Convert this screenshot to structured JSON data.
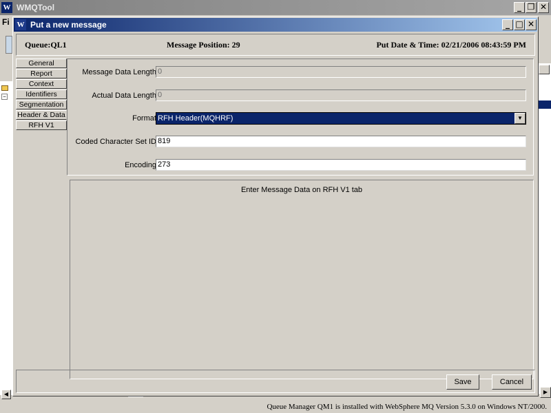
{
  "app": {
    "title": "WMQTool",
    "menu_fragment": "Fi",
    "status_text": "Queue Manager QM1  is installed with WebSphere MQ Version 5.3.0 on Windows NT/2000."
  },
  "dialog": {
    "title": "Put a new message",
    "header": {
      "queue": "Queue:QL1",
      "position": "Message Position: 29",
      "datetime": "Put Date & Time: 02/21/2006 08:43:59 PM"
    },
    "tabs": [
      {
        "label": "General"
      },
      {
        "label": "Report"
      },
      {
        "label": "Context"
      },
      {
        "label": "Identifiers"
      },
      {
        "label": "Segmentation"
      },
      {
        "label": "Header & Data"
      },
      {
        "label": "RFH V1"
      }
    ],
    "fields": {
      "data_length": {
        "label": "Message Data Length:",
        "value": "0"
      },
      "actual_length": {
        "label": "Actual Data Length:",
        "value": "0"
      },
      "format": {
        "label": "Format:",
        "value": "RFH Header(MQHRF)"
      },
      "ccsid": {
        "label": "Coded Character Set ID:",
        "value": "819"
      },
      "encoding": {
        "label": "Encoding:",
        "value": "273"
      }
    },
    "message": "Enter Message Data on RFH V1 tab",
    "buttons": {
      "save": "Save",
      "cancel": "Cancel"
    }
  },
  "colors": {
    "active_title": "#0a246a",
    "inactive_title": "#808080",
    "face": "#d4d0c8"
  }
}
